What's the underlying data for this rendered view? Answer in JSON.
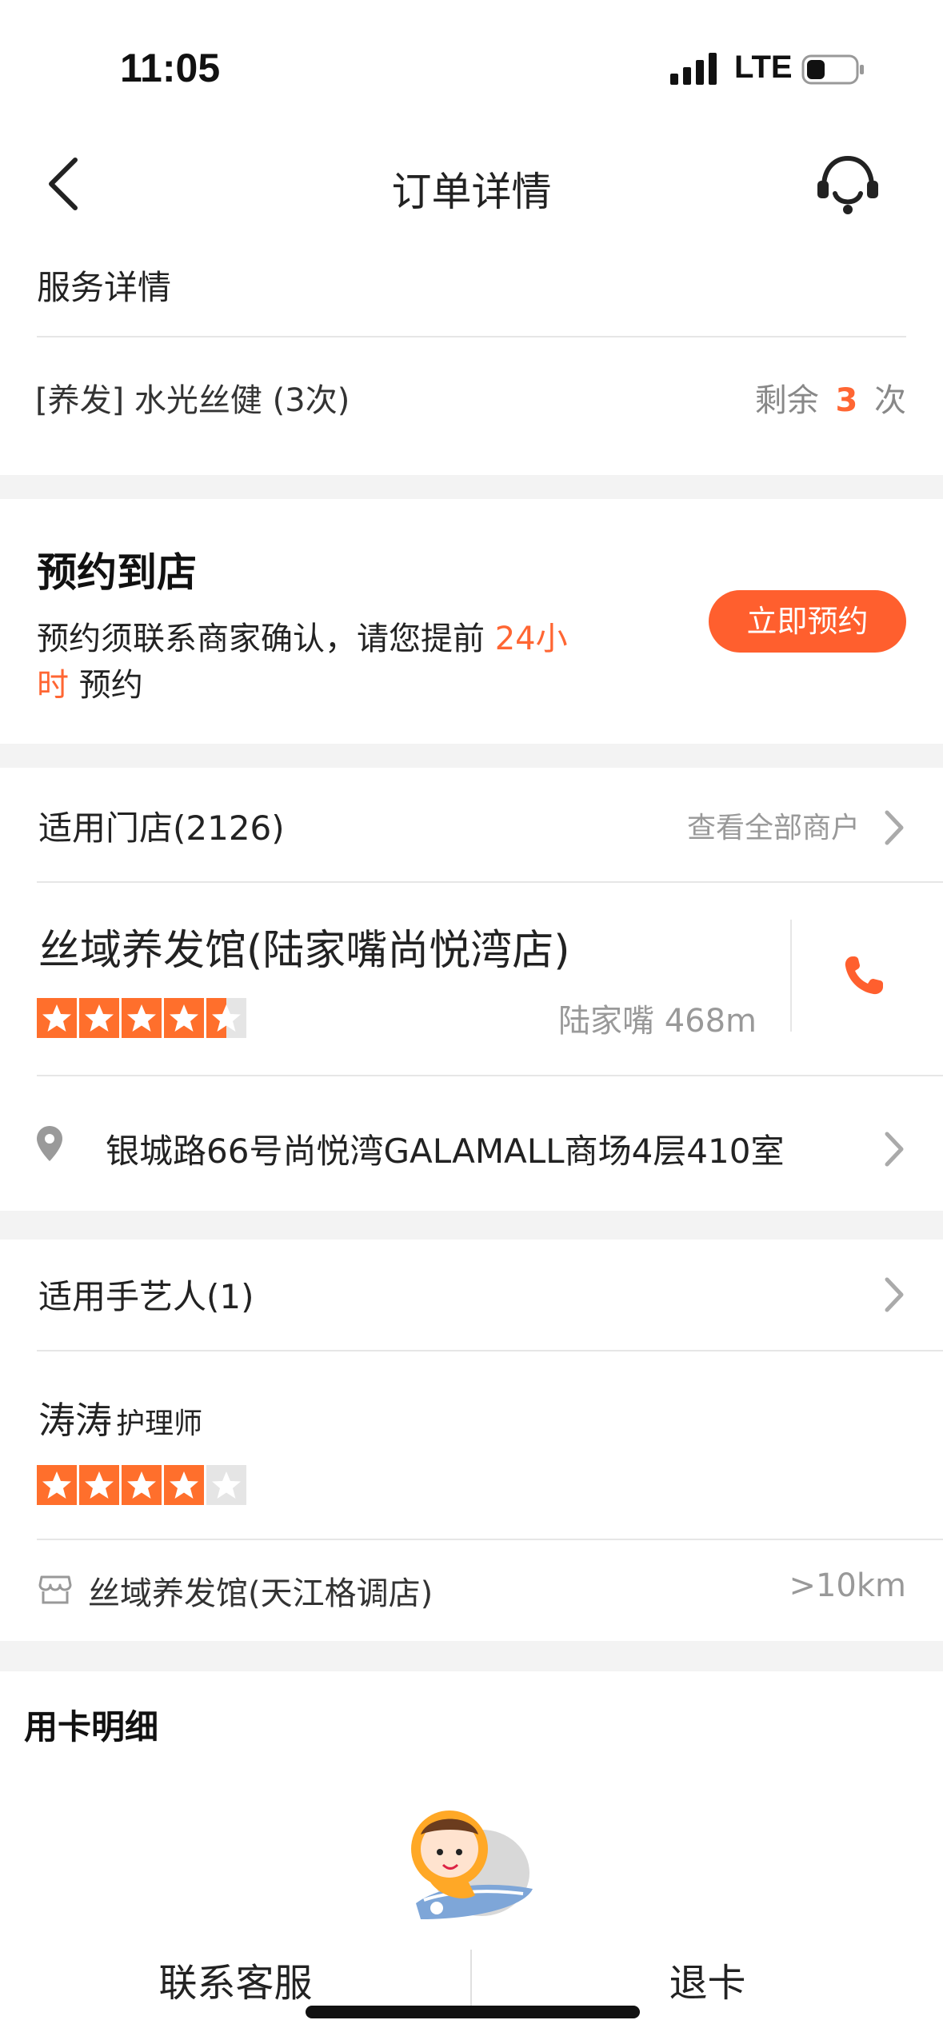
{
  "status_bar": {
    "time": "11:05",
    "network": "LTE"
  },
  "nav": {
    "title": "订单详情",
    "back_icon": "chevron-left-icon",
    "service_icon": "headset-icon"
  },
  "service": {
    "header": "服务详情",
    "item_name": "[养发] 水光丝健 (3次)",
    "remaining_prefix": "剩余",
    "remaining_count": "3",
    "remaining_suffix": "次"
  },
  "booking": {
    "title": "预约到店",
    "desc_line1": "预约须联系商家确认，请您提前",
    "highlight_a": "24小",
    "highlight_b": "时",
    "desc_tail": "预约",
    "button": "立即预约"
  },
  "stores": {
    "header": "适用门店(2126)",
    "view_all": "查看全部商户",
    "store_name": "丝域养发馆(陆家嘴尚悦湾店)",
    "rating": 4.5,
    "distance": "陆家嘴 468m",
    "address": "银城路66号尚悦湾GALAMALL商场4层410室"
  },
  "artisans": {
    "header": "适用手艺人(1)",
    "name": "涛涛",
    "role": "护理师",
    "rating": 4,
    "store": "丝域养发馆(天江格调店)",
    "distance": ">10km"
  },
  "card_details": {
    "title": "用卡明细"
  },
  "bottom": {
    "contact": "联系客服",
    "refund": "退卡"
  },
  "colors": {
    "accent": "#ff6633",
    "button": "#ff5f2e",
    "star": "#ff6f2c"
  }
}
